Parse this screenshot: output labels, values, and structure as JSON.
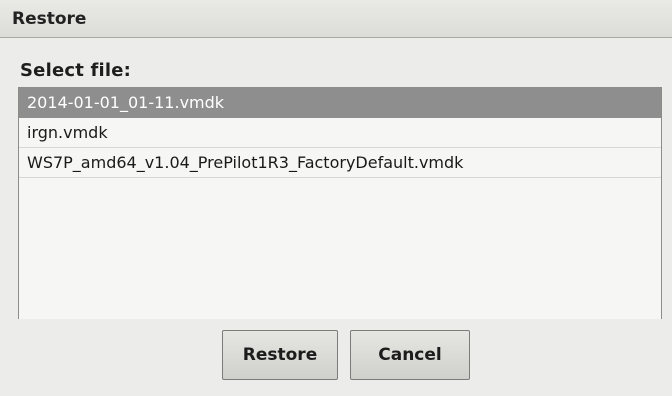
{
  "window": {
    "title": "Restore"
  },
  "dialog": {
    "prompt": "Select file:",
    "files": [
      {
        "label": "2014-01-01_01-11.vmdk",
        "selected": true
      },
      {
        "label": "irgn.vmdk",
        "selected": false
      },
      {
        "label": "WS7P_amd64_v1.04_PrePilot1R3_FactoryDefault.vmdk",
        "selected": false
      }
    ],
    "buttons": {
      "restore_label": "Restore",
      "cancel_label": "Cancel"
    }
  },
  "colors": {
    "selection": "#8e8e8e",
    "background": "#ecedea"
  }
}
